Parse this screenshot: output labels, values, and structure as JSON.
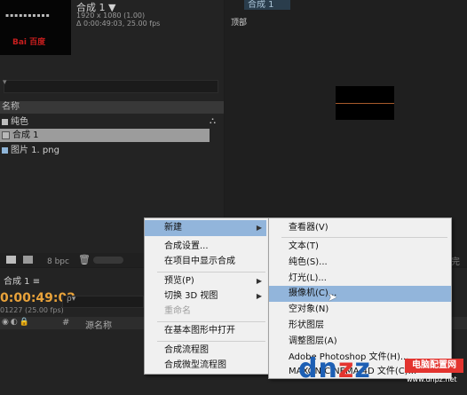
{
  "project": {
    "comp_name": "合成 1 ▼",
    "comp_size": "1920 x 1080 (1.00)",
    "comp_duration": "Δ 0:00:49:03, 25.00 fps",
    "thumbnail_logo": "Bai 百度",
    "thumbnail_dots": "▪▪▪▪▪▪▪▪▪▪",
    "search_glyph": "▾",
    "column_header": "名称",
    "items": [
      {
        "label": "纯色",
        "icon": "folder-icon",
        "color": "#bdbdbd"
      },
      {
        "label": "合成 1",
        "icon": "composition-icon",
        "color": "#b8b8b8"
      },
      {
        "label": "图片 1. png",
        "icon": "image-file-icon",
        "color": "#8fb5d8"
      }
    ],
    "network_glyph": "⛬",
    "bpc": "8 bpc",
    "trash_glyph": "🗑"
  },
  "composition": {
    "tab": "合成 1",
    "view_label": "顶部"
  },
  "timeline": {
    "tab": "合成 1 ≡",
    "timecode": "0:00:49:02",
    "fps": "01227 (25.00 fps)",
    "search_glyph": "ρ▾",
    "switch_glyph": "◉◐🔒",
    "hash": "#",
    "source_name": "源名称",
    "right_cut": "完整"
  },
  "main_menu": {
    "items": [
      {
        "label": "新建",
        "arrow": "▶"
      },
      {
        "label": "合成设置..."
      },
      {
        "label": "在项目中显示合成"
      },
      {
        "label": "预览(P)",
        "arrow": "▶"
      },
      {
        "label": "切换 3D 视图",
        "arrow": "▶"
      },
      {
        "label": "重命名"
      },
      {
        "label": "在基本图形中打开"
      },
      {
        "label": "合成流程图"
      },
      {
        "label": "合成微型流程图"
      }
    ]
  },
  "sub_menu": {
    "items": [
      {
        "label": "查看器(V)"
      },
      {
        "label": "文本(T)"
      },
      {
        "label": "纯色(S)..."
      },
      {
        "label": "灯光(L)..."
      },
      {
        "label": "摄像机(C)..."
      },
      {
        "label": "空对象(N)"
      },
      {
        "label": "形状图层"
      },
      {
        "label": "调整图层(A)"
      },
      {
        "label": "Adobe Photoshop 文件(H)..."
      },
      {
        "label": "MAXON CINEMA 4D 文件(C)..."
      }
    ]
  },
  "cursor_glyph": "➤",
  "watermark": {
    "logo_prefix": "dn",
    "logo_z": "z",
    "logo_suffix": "z",
    "badge": "电脑配置网",
    "url": "www.dnpz.net"
  },
  "colors": {
    "timecode": "#e8a23a",
    "menu_highlight": "#92b5db",
    "watermark_blue": "#1d5fb4",
    "watermark_red": "#e3342f"
  }
}
